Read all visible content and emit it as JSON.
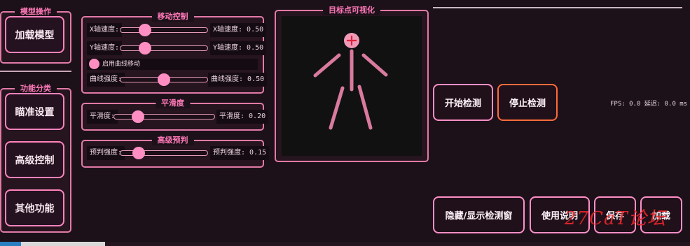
{
  "left_panel": {
    "model_group_title": "模型操作",
    "load_model_button": "加载模型",
    "func_group_title": "功能分类",
    "nav_buttons": [
      "瞄准设置",
      "高级控制",
      "其他功能"
    ]
  },
  "move_control": {
    "title": "移动控制",
    "x_speed_label": "X轴速度:",
    "x_speed_value": "X轴速度: 0.50",
    "x_speed": 0.5,
    "y_speed_label": "Y轴速度:",
    "y_speed_value": "Y轴速度: 0.50",
    "y_speed": 0.5,
    "curve_toggle_label": "启用曲线移动",
    "curve_strength_label": "曲线强度:",
    "curve_strength_value": "曲线强度: 0.50",
    "curve_strength": 0.5
  },
  "smoothing": {
    "title": "平滑度",
    "label": "平滑度:",
    "value": "平滑度: 0.20",
    "level": 0.2
  },
  "prediction": {
    "title": "高级预判",
    "label": "预判强度:",
    "value": "预判强度: 0.15",
    "level": 0.15
  },
  "visualization": {
    "title": "目标点可视化"
  },
  "detection": {
    "start_button": "开始检测",
    "stop_button": "停止检测",
    "fps_text": "FPS: 0.0 延迟: 0.0 ms"
  },
  "bottom_buttons": {
    "toggle_window": "隐藏/显示检测窗",
    "help": "使用说明",
    "save": "保存",
    "load": "加载"
  },
  "watermark": "27CaT论坛",
  "colors": {
    "accent": "#ff83bd",
    "background": "#1c1119",
    "stop_border": "#ff6b3c",
    "watermark": "#e8262b"
  }
}
